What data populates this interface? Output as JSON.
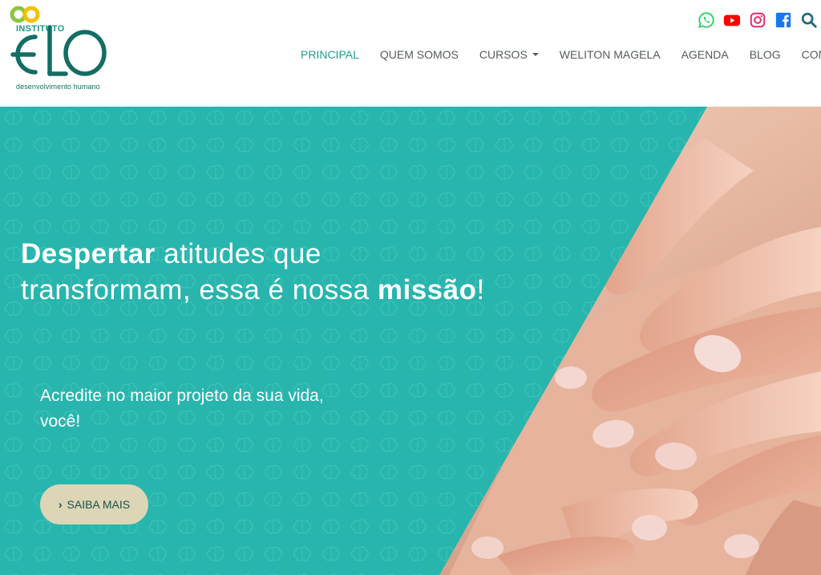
{
  "brand": {
    "small_label": "INSTITUTO",
    "big_label": "ELO",
    "tagline": "desenvolvimento humano",
    "colors": {
      "teal": "#27b5ad",
      "dark_teal": "#136d63",
      "green": "#8bc53f",
      "yellow": "#f2c100"
    }
  },
  "social": [
    {
      "icon": "whatsapp-icon",
      "color": "#25d366"
    },
    {
      "icon": "youtube-icon",
      "color": "#ff0000"
    },
    {
      "icon": "instagram-icon",
      "color": "#e1306c"
    },
    {
      "icon": "facebook-icon",
      "color": "#1877f2"
    },
    {
      "icon": "search-icon",
      "color": "#1f6e78"
    }
  ],
  "nav": {
    "items": [
      {
        "label": "PRINCIPAL",
        "active": true
      },
      {
        "label": "QUEM SOMOS"
      },
      {
        "label": "CURSOS",
        "dropdown": true
      },
      {
        "label": "WELITON MAGELA"
      },
      {
        "label": "AGENDA"
      },
      {
        "label": "BLOG"
      },
      {
        "label": "CONTATO"
      }
    ]
  },
  "hero": {
    "headline": {
      "bold_1": "Despertar",
      "text_1": " atitudes que",
      "text_2": "transformam, essa é nossa ",
      "bold_2": "missão",
      "text_3": "!"
    },
    "subline_1": "Acredite no maior projeto da sua vida,",
    "subline_2": "você!",
    "cta_label": "SAIBA MAIS",
    "accent_color": "#27b5ad",
    "button_color": "#dcd6b6"
  }
}
